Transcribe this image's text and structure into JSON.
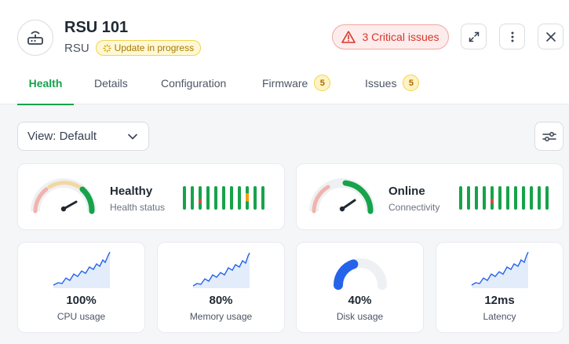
{
  "device": {
    "name": "RSU 101",
    "type": "RSU",
    "status": "Update in progress"
  },
  "header": {
    "critical_label": "3 Critical issues"
  },
  "tabs": [
    {
      "label": "Health",
      "badge": null,
      "active": true
    },
    {
      "label": "Details",
      "badge": null,
      "active": false
    },
    {
      "label": "Configuration",
      "badge": null,
      "active": false
    },
    {
      "label": "Firmware",
      "badge": "5",
      "active": false
    },
    {
      "label": "Issues",
      "badge": "5",
      "active": false
    }
  ],
  "view": {
    "selected": "View: Default"
  },
  "health": {
    "label": "Healthy",
    "sub": "Health status",
    "history": [
      "ok",
      "ok",
      "warn-low",
      "ok",
      "ok",
      "ok",
      "ok",
      "ok",
      "warn",
      "ok",
      "ok"
    ]
  },
  "connectivity": {
    "label": "Online",
    "sub": "Connectivity",
    "history": [
      "ok",
      "ok",
      "ok",
      "ok",
      "error-low",
      "ok",
      "ok",
      "ok",
      "ok",
      "ok",
      "ok",
      "ok"
    ]
  },
  "metrics": [
    {
      "value": "100%",
      "label": "CPU usage",
      "kind": "sparkline"
    },
    {
      "value": "80%",
      "label": "Memory usage",
      "kind": "sparkline"
    },
    {
      "value": "40%",
      "label": "Disk usage",
      "kind": "gauge",
      "fraction": 0.4
    },
    {
      "value": "12ms",
      "label": "Latency",
      "kind": "sparkline"
    }
  ],
  "colors": {
    "green": "#16a34a",
    "red": "#e2483d",
    "orange": "#f59e0b",
    "blue": "#2563eb",
    "accent_tab": "#16a34a"
  },
  "icons": {
    "device": "router-icon",
    "critical": "warning-triangle-icon",
    "expand": "expand-icon",
    "more": "more-vertical-icon",
    "close": "close-icon",
    "dropdown": "chevron-down-icon",
    "filter": "sliders-icon",
    "status": "spinner-icon"
  }
}
